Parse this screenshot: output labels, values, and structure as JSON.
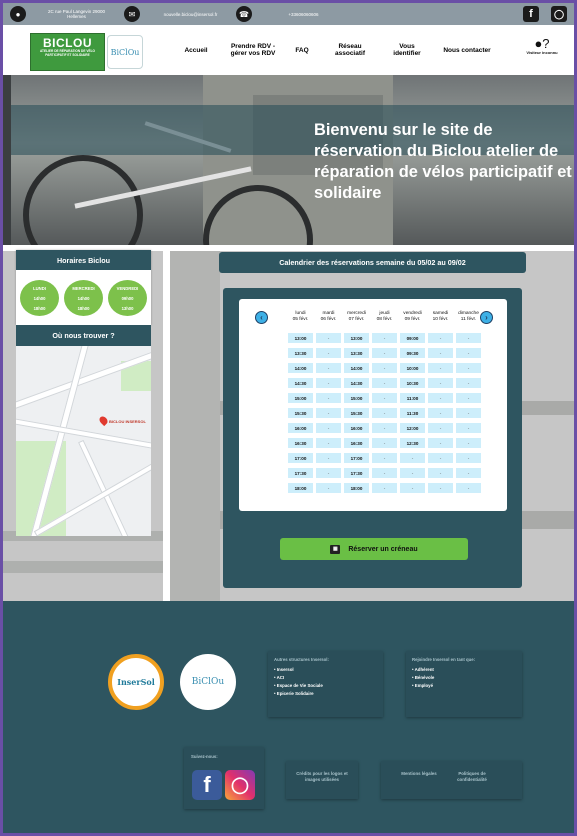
{
  "topbar": {
    "address": "2C rue Paul Langevin 29000 Hellemes",
    "email": "nouvelle.biclou@insersol.fr",
    "phone": "+33606060606",
    "bike_icon": "bicycle-icon",
    "mail_icon": "envelope-icon",
    "phone_icon": "whatsapp-icon",
    "facebook_icon": "facebook-icon",
    "instagram_icon": "instagram-icon"
  },
  "logos": {
    "biclou_title": "BICLOU",
    "biclou_subtitle": "ATELIER DE RÉPARATION DE VÉLO PARTICIPATIF ET SOLIDAIRE",
    "biclou2_text": "BiClOu"
  },
  "nav": {
    "items": [
      "Accueil",
      "Prendre RDV - gérer vos RDV",
      "FAQ",
      "Réseau associatif",
      "Vous identifier",
      "Nous contacter"
    ],
    "user_label": "Visiteur inconnu",
    "user_icon": "user-question-icon"
  },
  "hero": {
    "title": "Bienvenu sur le site de réservation du Biclou atelier de réparation de vélos participatif et solidaire"
  },
  "hours": {
    "title": "Horaires Biclou",
    "days": [
      {
        "day": "LUNDI",
        "open": "14h00",
        "close": "18h00"
      },
      {
        "day": "MERCREDI",
        "open": "14h00",
        "close": "18h00"
      },
      {
        "day": "VENDREDI",
        "open": "09h00",
        "close": "13h00"
      }
    ]
  },
  "location": {
    "title": "Où nous trouver ?",
    "pin_label": "BICLOU INSERSOL"
  },
  "calendar": {
    "title": "Calendrier des réservations semaine du 05/02 au  09/02",
    "days": [
      {
        "name": "lundi",
        "date": "05 févr."
      },
      {
        "name": "mardi",
        "date": "06 févr."
      },
      {
        "name": "mercredi",
        "date": "07 févr."
      },
      {
        "name": "jeudi",
        "date": "08 févr."
      },
      {
        "name": "vendredi",
        "date": "09 févr."
      },
      {
        "name": "samedi",
        "date": "10 févr."
      },
      {
        "name": "dimanche",
        "date": "11 févr."
      }
    ],
    "columns": [
      [
        "13:00",
        "13:30",
        "14:00",
        "14:30",
        "15:00",
        "15:30",
        "16:00",
        "16:30",
        "17:00",
        "17:30",
        "18:00"
      ],
      [
        "-",
        "-",
        "-",
        "-",
        "-",
        "-",
        "-",
        "-",
        "-",
        "-",
        "-"
      ],
      [
        "13:00",
        "13:30",
        "14:00",
        "14:30",
        "15:00",
        "15:30",
        "16:00",
        "16:30",
        "17:00",
        "17:30",
        "18:00"
      ],
      [
        "-",
        "-",
        "-",
        "-",
        "-",
        "-",
        "-",
        "-",
        "-",
        "-",
        "-"
      ],
      [
        "09:00",
        "09:30",
        "10:00",
        "10:30",
        "11:00",
        "11:30",
        "12:00",
        "12:30",
        "-",
        "-",
        "-"
      ],
      [
        "-",
        "-",
        "-",
        "-",
        "-",
        "-",
        "-",
        "-",
        "-",
        "-",
        "-"
      ],
      [
        "-",
        "-",
        "-",
        "-",
        "-",
        "-",
        "-",
        "-",
        "-",
        "-",
        "-"
      ]
    ],
    "reserve_label": "Réserver un créneau",
    "prev_icon": "chevron-left-icon",
    "next_icon": "chevron-right-icon"
  },
  "footer": {
    "insersol_text": "InserSol",
    "biclou_text": "BiClOu",
    "other_title": "Autres structures Insersol:",
    "other_items": [
      "Insersol",
      "ACI",
      "Espace de Vie Sociale",
      "Epicerie Solidaire"
    ],
    "join_title": "Rejoindre Insersol en tant que:",
    "join_items": [
      "Adhérent",
      "Bénévole",
      "Employé"
    ],
    "follow": "Suivez-nous:",
    "credits": "Crédits pour les logos et images utilisées",
    "legal": "Mentions légales",
    "privacy": "Politiques de confidentialité"
  }
}
